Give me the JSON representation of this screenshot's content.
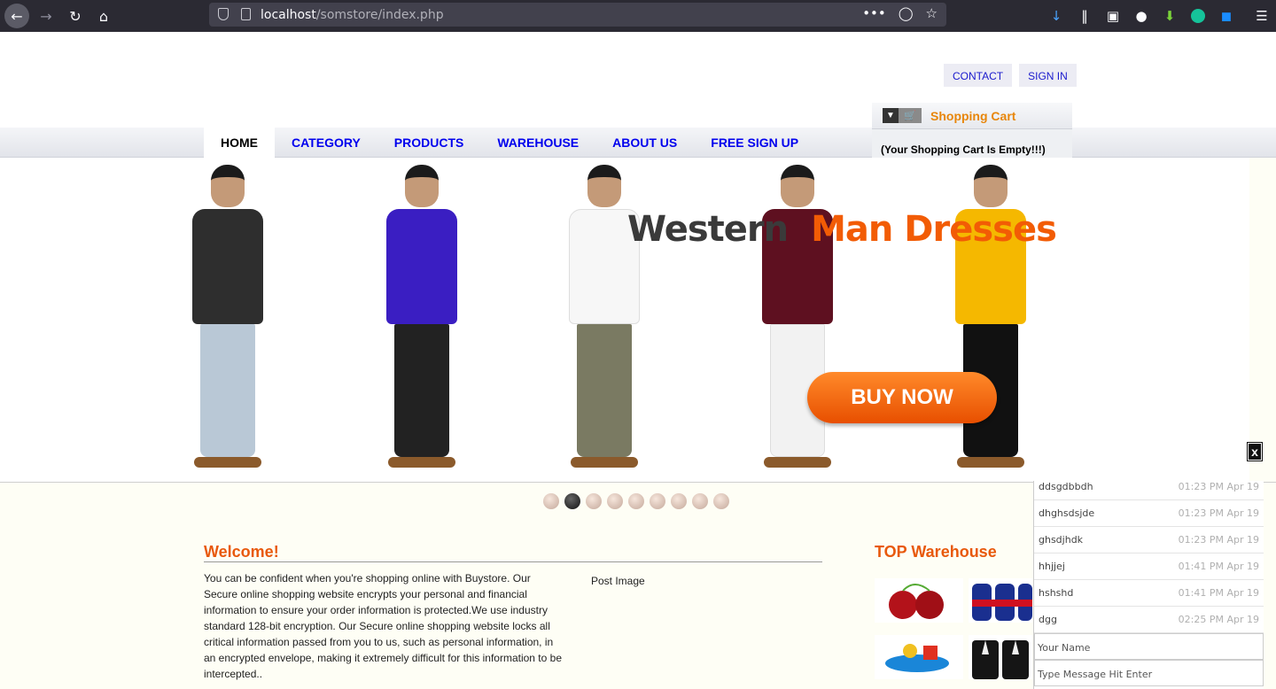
{
  "browser": {
    "url_host": "localhost",
    "url_path": "/somstore/index.php",
    "page_actions": "•••"
  },
  "top_links": {
    "contact": "CONTACT",
    "sign_in": "SIGN IN"
  },
  "nav": {
    "items": [
      {
        "label": "HOME",
        "active": true
      },
      {
        "label": "CATEGORY"
      },
      {
        "label": "PRODUCTS"
      },
      {
        "label": "WAREHOUSE"
      },
      {
        "label": "ABOUT US"
      },
      {
        "label": "FREE SIGN UP"
      }
    ]
  },
  "cart": {
    "title": "Shopping Cart",
    "empty_text": "(Your Shopping Cart Is Empty!!!)"
  },
  "banner": {
    "headline_part1": "Western",
    "headline_part2": "Man Dresses",
    "buy_label": "BUY NOW",
    "shirt_colors": [
      "#2e2e2e",
      "#3a1ec2",
      "#f7f7f7",
      "#5e1020",
      "#f5b800"
    ],
    "pant_colors": [
      "#b9c8d6",
      "#222222",
      "#7a7a62",
      "#f2f2f2",
      "#111111"
    ],
    "slides_total": 9,
    "slide_active": 2
  },
  "welcome": {
    "title": "Welcome!",
    "text": "You can be confident when you're shopping online with Buystore. Our Secure online shopping website encrypts your personal and financial information to ensure your order information is protected.We use industry standard 128-bit encryption. Our Secure online shopping website locks all critical information passed from you to us, such as personal information, in an encrypted envelope, making it extremely difficult for this information to be intercepted..",
    "post_image": "Post Image"
  },
  "top_warehouse": {
    "title": "TOP Warehouse"
  },
  "chat": {
    "close": "x",
    "messages": [
      {
        "text": "ddsgdbbdh",
        "time": "01:23 PM Apr 19"
      },
      {
        "text": "dhghsdsjde",
        "time": "01:23 PM Apr 19"
      },
      {
        "text": "ghsdjhdk",
        "time": "01:23 PM Apr 19"
      },
      {
        "text": "hhjjej",
        "time": "01:41 PM Apr 19"
      },
      {
        "text": "hshshd",
        "time": "01:41 PM Apr 19"
      },
      {
        "text": "dgg",
        "time": "02:25 PM Apr 19"
      }
    ],
    "name_placeholder": "Your Name",
    "message_placeholder": "Type Message Hit Enter"
  }
}
